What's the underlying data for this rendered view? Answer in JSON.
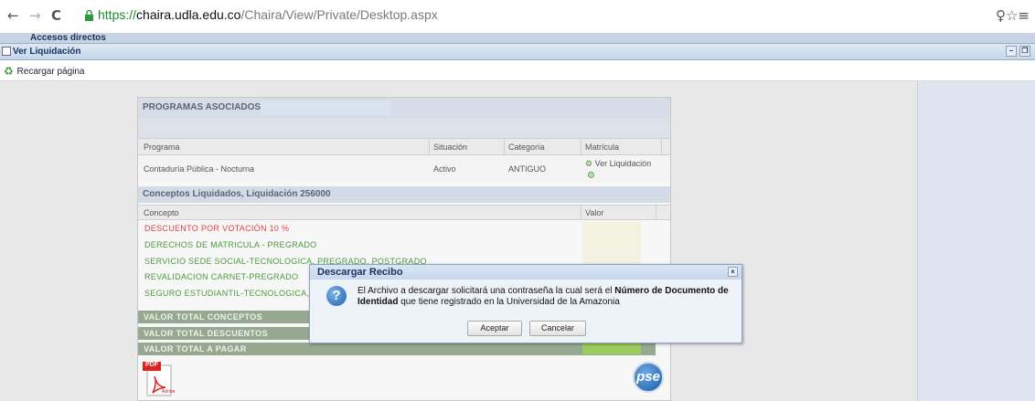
{
  "browser": {
    "back": "←",
    "forward": "→",
    "reload": "C",
    "url_scheme": "https://",
    "url_host": "chaira.udla.edu.co",
    "url_path": "/Chaira/View/Private/Desktop.aspx",
    "right_icons": "♀☆≡"
  },
  "app": {
    "accesos_label": "Accesos directos",
    "window_title": "Ver Liquidación",
    "reload_label": "Recargar página"
  },
  "programs": {
    "header": "PROGRAMAS ASOCIADOS A",
    "columns": [
      "Programa",
      "Situación",
      "Categoría",
      "Matrícula"
    ],
    "rows": [
      {
        "programa": "Contaduría Pública - Nocturna",
        "situacion": "Activo",
        "categoria": "ANTIGUO",
        "matricula": "Ver Liquidación"
      }
    ]
  },
  "concepts": {
    "header": "Conceptos Liquidados, Liquidación 256000",
    "col_concepto": "Concepto",
    "col_valor": "Valor",
    "items": [
      {
        "label": "DESCUENTO POR VOTACIÓN 10 %",
        "color": "#e24040"
      },
      {
        "label": "DERECHOS DE MATRICULA - PREGRADO",
        "color": "#4a9a3a"
      },
      {
        "label": "SERVICIO SEDE SOCIAL-TECNOLOGICA, PREGRADO, POSTGRADO",
        "color": "#4a9a3a"
      },
      {
        "label": "REVALIDACION CARNET-PREGRADO",
        "color": "#4a9a3a"
      },
      {
        "label": "SEGURO ESTUDIANTIL-TECNOLOGICA, P",
        "color": "#4a9a3a"
      }
    ],
    "totals": [
      "VALOR TOTAL CONCEPTOS",
      "VALOR TOTAL DESCUENTOS",
      "VALOR TOTAL A PAGAR"
    ]
  },
  "footer": {
    "pdf_label": "PDF",
    "adobe_label": "Adobe",
    "pse_label": "pse"
  },
  "dialog": {
    "title": "Descargar Recibo",
    "close": "×",
    "icon": "?",
    "msg_part1": "El Archivo a descargar solicitará una contraseña la cual será el ",
    "msg_bold1": "Número de Documento de Identidad",
    "msg_part2": " que tiene registrado en la Universidad de la Amazonia",
    "accept": "Aceptar",
    "cancel": "Cancelar"
  }
}
